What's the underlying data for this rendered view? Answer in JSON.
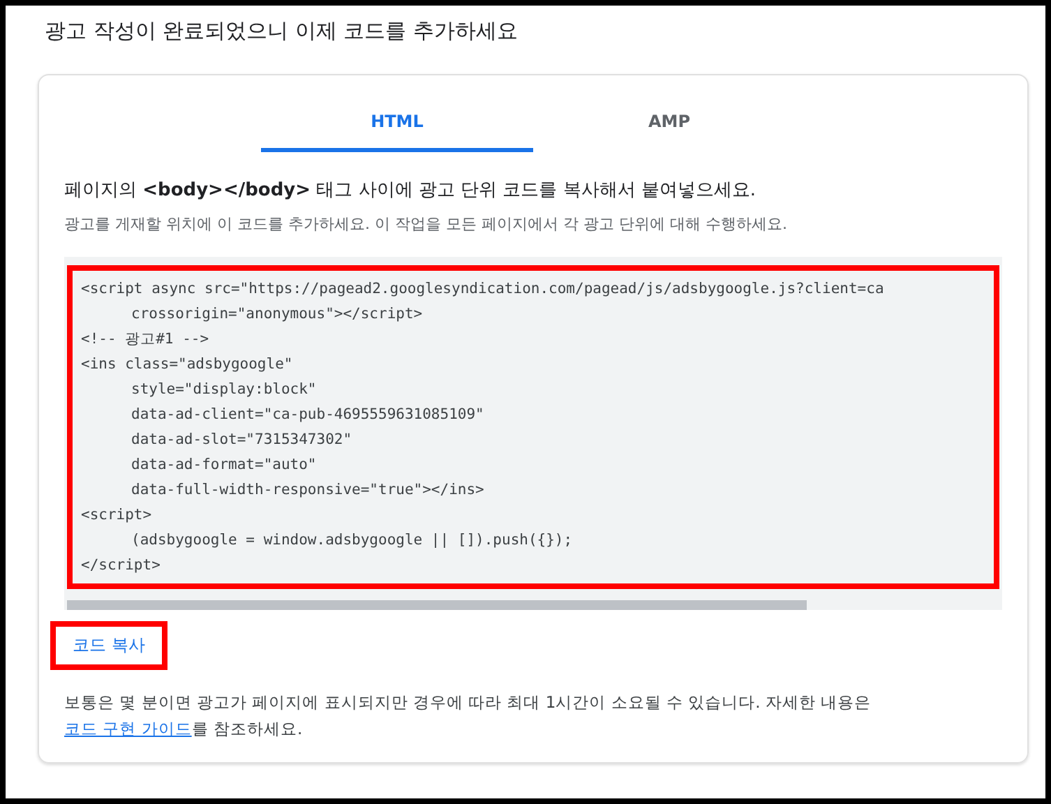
{
  "title": "광고 작성이 완료되었으니 이제 코드를 추가하세요",
  "tabs": [
    {
      "label": "HTML",
      "selected": true
    },
    {
      "label": "AMP",
      "selected": false
    }
  ],
  "instruction": "페이지의 **<body></body>** 태그 사이에 광고 단위 코드를 복사해서 붙여넣으세요.",
  "note": "광고를 게재할 위치에 이 코드를 추가하세요. 이 작업을 모든 페이지에서 각 광고 단위에 대해 수행하세요.",
  "code": {
    "highlighted": true,
    "lines": [
      {
        "text": "<script async src=\"https://pagead2.googlesyndication.com/pagead/js/adsbygoogle.js?client=ca",
        "indented": false
      },
      {
        "text": "crossorigin=\"anonymous\"></script>",
        "indented": true
      },
      {
        "text": "<!-- 광고#1 -->",
        "indented": false
      },
      {
        "text": "<ins class=\"adsbygoogle\"",
        "indented": false
      },
      {
        "text": "style=\"display:block\"",
        "indented": true
      },
      {
        "text": "data-ad-client=\"ca-pub-4695559631085109\"",
        "indented": true
      },
      {
        "text": "data-ad-slot=\"7315347302\"",
        "indented": true
      },
      {
        "text": "data-ad-format=\"auto\"",
        "indented": true
      },
      {
        "text": "data-full-width-responsive=\"true\"></ins>",
        "indented": true
      },
      {
        "text": "<script>",
        "indented": false
      },
      {
        "text": "(adsbygoogle = window.adsbygoogle || []).push({});",
        "indented": true
      },
      {
        "text": "</script>",
        "indented": false
      }
    ]
  },
  "copy_button": {
    "label": "코드 복사",
    "highlighted": true
  },
  "footer": {
    "text": "보통은 몇 분이면 광고가 페이지에 표시되지만 경우에 따라 최대 1시간이 소요될 수 있습니다. 자세한 내용은",
    "link": "코드 구현 가이드",
    "after": "를 참조하세요."
  }
}
